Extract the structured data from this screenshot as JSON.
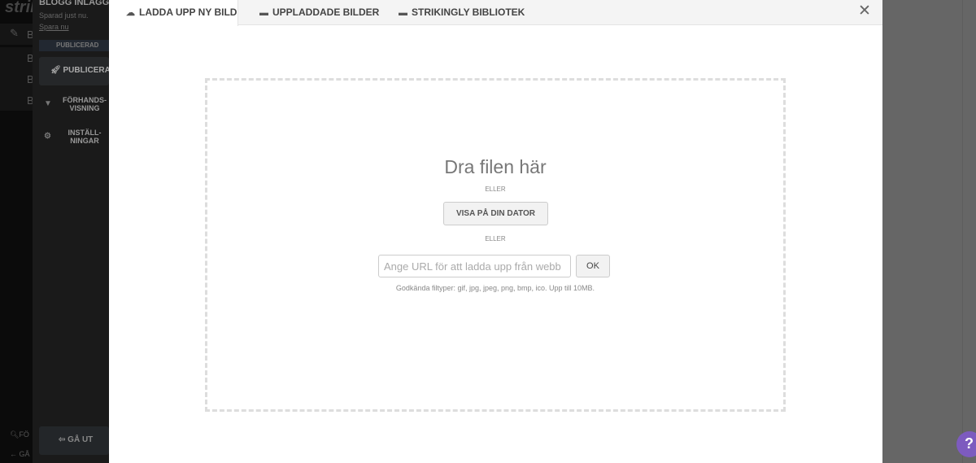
{
  "app": {
    "logo": "strik",
    "rows": [
      "B",
      "B",
      "B",
      "B"
    ],
    "bottom": [
      "FÖ",
      "GÅ"
    ]
  },
  "sidebar": {
    "title": "BLOGG INLÄGG",
    "saved": "Sparad just nu.",
    "save_link": "Spara nu",
    "status": "PUBLICERAD",
    "publish": "PUBLICERA",
    "preview": "FÖRHANDS-VISNING",
    "settings": "INSTÄLL-NINGAR",
    "exit": "GÅ UT"
  },
  "modal": {
    "tabs": [
      {
        "label": "LADDA UPP NY BILD",
        "icon": "cloud-upload-icon"
      },
      {
        "label": "UPPLADDADE BILDER",
        "icon": "folder-icon"
      },
      {
        "label": "STRIKINGLY BIBLIOTEK",
        "icon": "archive-icon"
      }
    ],
    "drop_title": "Dra filen här",
    "or": "ELLER",
    "browse": "VISA PÅ DIN DATOR",
    "url_placeholder": "Ange URL för att ladda upp från webb",
    "ok": "OK",
    "hint": "Godkända filtyper: gif, jpg, jpeg, png, bmp, ico. Upp till 10MB."
  },
  "help": "?",
  "colors": {
    "help": "#7d5bbf",
    "overlay": "#666666"
  }
}
